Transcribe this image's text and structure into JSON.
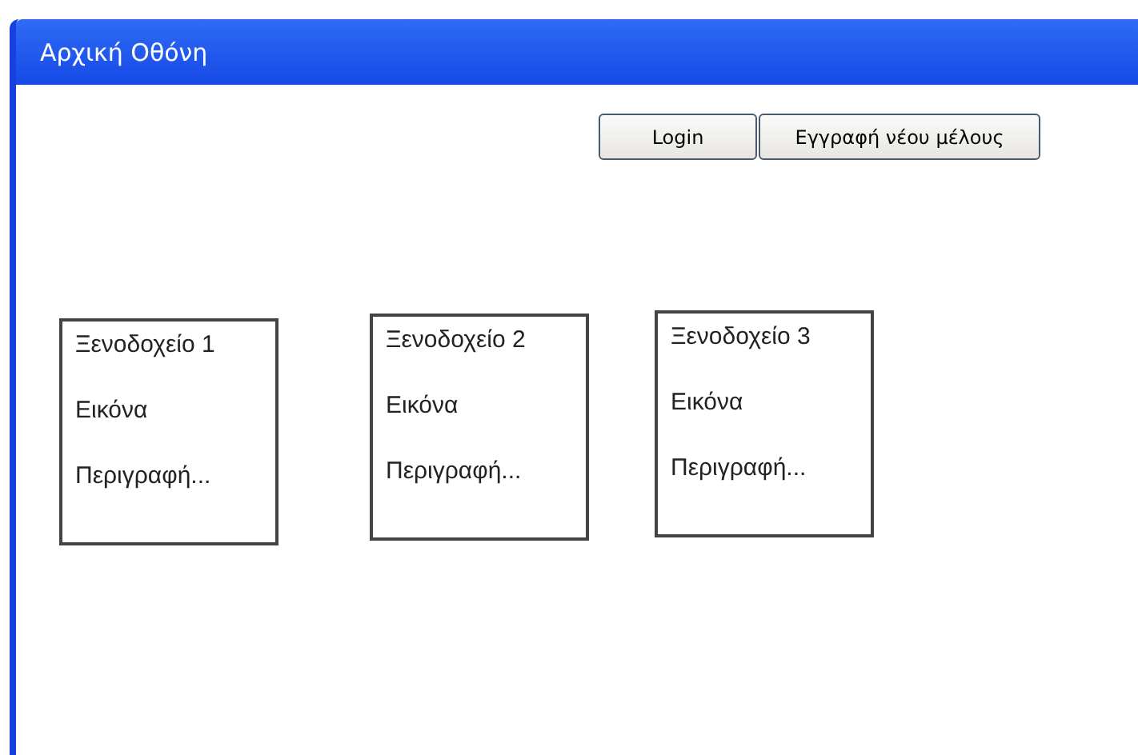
{
  "window": {
    "title": "Αρχική Οθόνη"
  },
  "buttons": [
    "Login",
    "Εγγραφή νέου μέλους"
  ],
  "hotels": [
    {
      "name": "Ξενοδοχείο 1",
      "image": "Εικόνα",
      "description": "Περιγραφή..."
    },
    {
      "name": "Ξενοδοχείο 2",
      "image": "Εικόνα",
      "description": "Περιγραφή..."
    },
    {
      "name": "Ξενοδοχείο 3",
      "image": "Εικόνα",
      "description": "Περιγραφή..."
    }
  ]
}
